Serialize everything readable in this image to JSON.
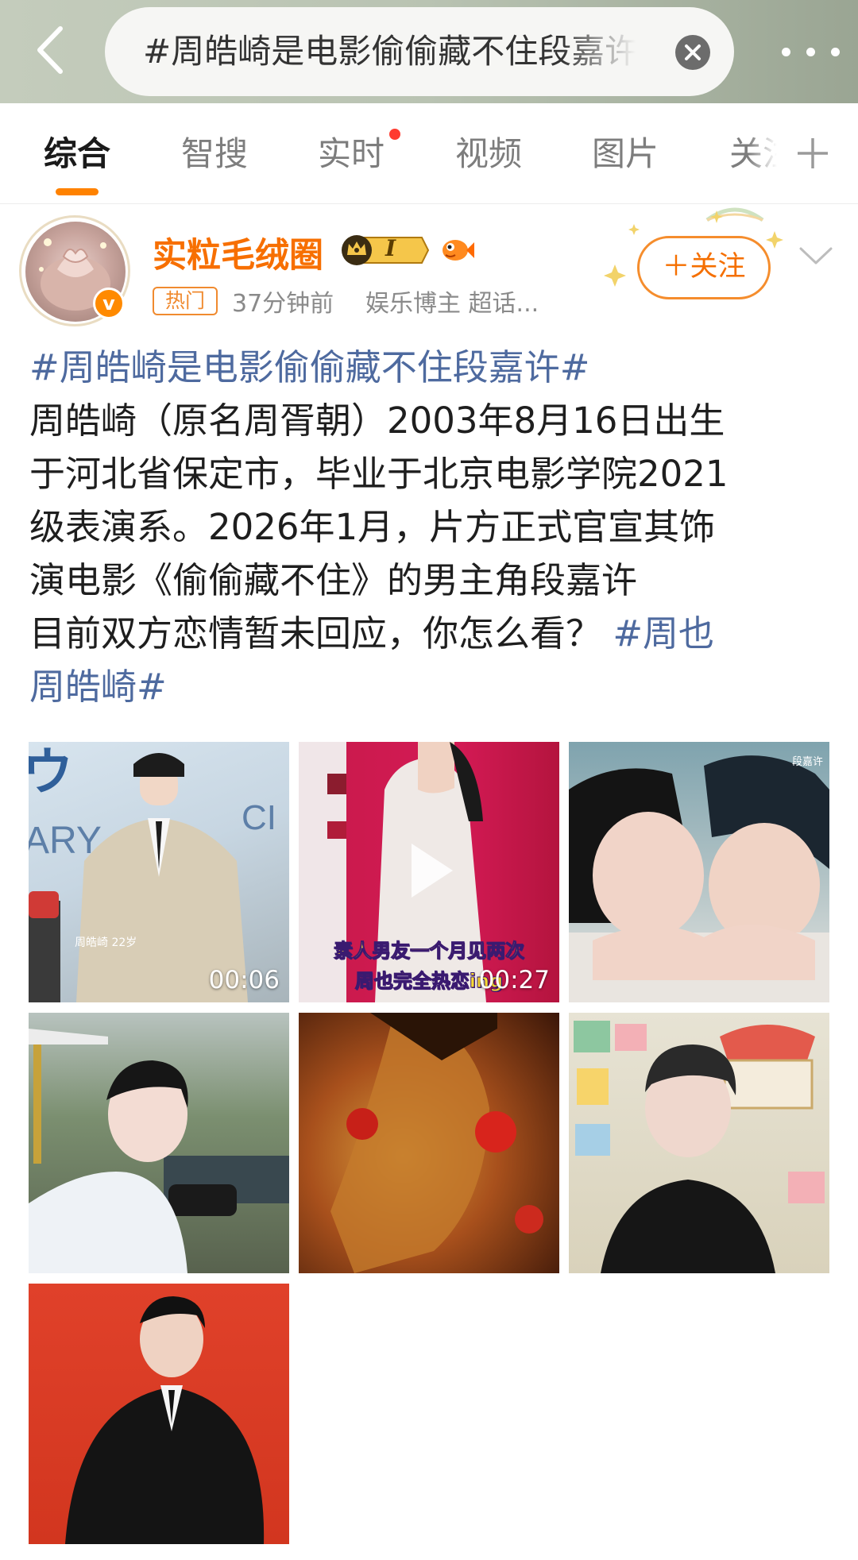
{
  "search": {
    "query": "#周皓崎是电影偷偷藏不住段嘉许#"
  },
  "tabs": [
    {
      "label": "综合"
    },
    {
      "label": "智搜"
    },
    {
      "label": "实时"
    },
    {
      "label": "视频"
    },
    {
      "label": "图片"
    },
    {
      "label": "关注"
    }
  ],
  "post": {
    "author": "实粒毛绒圈",
    "level": "I",
    "hot_tag": "热门",
    "time": "37分钟前",
    "source": "娱乐博主 超话...",
    "follow_label": "＋关注",
    "text": {
      "hashtag_title": "#周皓崎是电影偷偷藏不住段嘉许#",
      "line1": "周皓崎（原名周胥朝）2003年8月16日出生",
      "line2": "于河北省保定市，毕业于北京电影学院2021",
      "line3": "级表演系。2026年1月，片方正式官宣其饰",
      "line4": "演电影《偷偷藏不住》的男主角段嘉许",
      "line5": "目前双方恋情暂未回应，你怎么看？",
      "hashtag_end_a": "#周也",
      "hashtag_end_b": "周皓崎#"
    },
    "media": [
      {
        "type": "video",
        "duration": "00:06",
        "caption": "周皓崎 22岁"
      },
      {
        "type": "video",
        "duration": "00:27",
        "caption_line1": "素人男友一个月见两次",
        "caption_line2": "周也完全热恋ing"
      },
      {
        "type": "image",
        "caption": "段嘉许"
      },
      {
        "type": "image"
      },
      {
        "type": "image"
      },
      {
        "type": "image"
      },
      {
        "type": "image"
      }
    ]
  },
  "colors": {
    "accent": "#ff8200",
    "username": "#f76f00",
    "hashtag": "#4e6a9f"
  }
}
